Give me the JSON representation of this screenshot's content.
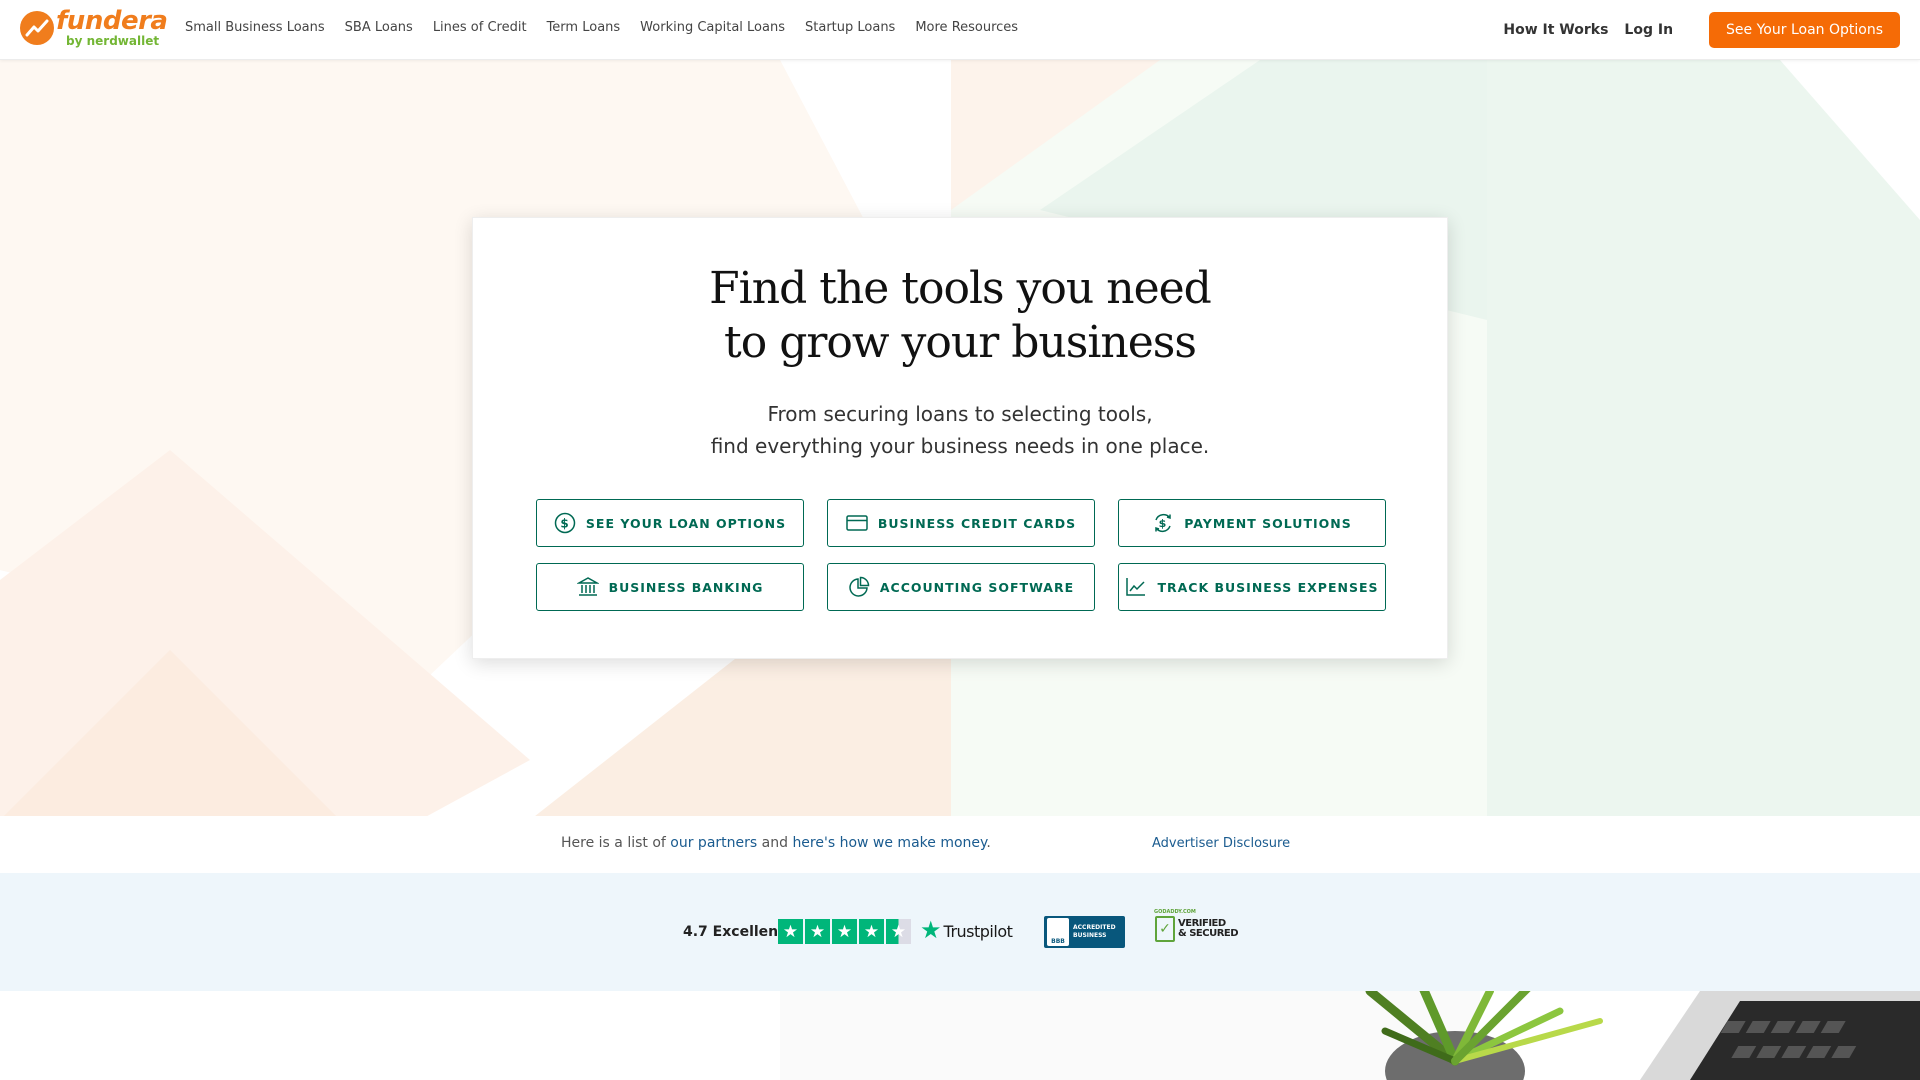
{
  "header": {
    "logo_word": "fundera",
    "logo_sub": "by nerdwallet",
    "nav": [
      "Small Business Loans",
      "SBA Loans",
      "Lines of Credit",
      "Term Loans",
      "Working Capital Loans",
      "Startup Loans",
      "More Resources"
    ],
    "how_it_works": "How It Works",
    "login": "Log In",
    "cta": "See Your Loan Options"
  },
  "hero": {
    "title_line1": "Find the tools you need",
    "title_line2": "to grow your business",
    "subtitle_line1": "From securing loans to selecting tools,",
    "subtitle_line2": "find everything your business needs in one place.",
    "buttons": [
      {
        "label": "See Your Loan Options",
        "icon": "dollar-circle-icon"
      },
      {
        "label": "Business Credit Cards",
        "icon": "credit-card-icon"
      },
      {
        "label": "Payment Solutions",
        "icon": "dollar-cycle-icon"
      },
      {
        "label": "Business Banking",
        "icon": "bank-icon"
      },
      {
        "label": "Accounting Software",
        "icon": "pie-chart-icon"
      },
      {
        "label": "Track Business Expenses",
        "icon": "line-chart-icon"
      }
    ]
  },
  "disclosure": {
    "prefix": "Here is a list of ",
    "partners_link": "our partners",
    "middle": " and ",
    "money_link": "here's how we make money",
    "suffix": ".",
    "advertiser": "Advertiser Disclosure"
  },
  "trust": {
    "rating": "4.7 Excellent",
    "stars_filled": 4.5,
    "stars_total": 5,
    "trustpilot": "Trustpilot",
    "bbb_logo": "BBB",
    "bbb_text_1": "ACCREDITED",
    "bbb_text_2": "BUSINESS",
    "secure_small": "GODADDY.COM",
    "secure_line1": "VERIFIED",
    "secure_line2": "& SECURED"
  },
  "colors": {
    "brand_orange": "#f07d1d",
    "cta_orange": "#f56b06",
    "brand_green": "#73b634",
    "button_green": "#006953",
    "link_blue": "#1a5b8f",
    "trustpilot_green": "#00b67a"
  }
}
